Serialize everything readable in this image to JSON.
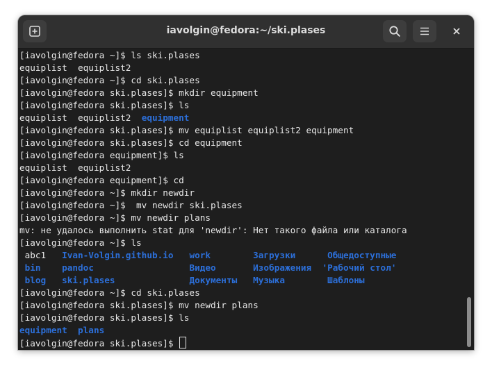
{
  "window": {
    "title": "iavolgin@fedora:~/ski.plases"
  },
  "terminal": {
    "lines": [
      [
        {
          "t": "[iavolgin@fedora ~]$ ls ski.plases"
        }
      ],
      [
        {
          "t": "equiplist  equiplist2"
        }
      ],
      [
        {
          "t": "[iavolgin@fedora ~]$ cd ski.plases"
        }
      ],
      [
        {
          "t": "[iavolgin@fedora ski.plases]$ mkdir equipment"
        }
      ],
      [
        {
          "t": "[iavolgin@fedora ski.plases]$ ls"
        }
      ],
      [
        {
          "t": "equiplist  equiplist2  "
        },
        {
          "t": "equipment",
          "dir": true
        }
      ],
      [
        {
          "t": "[iavolgin@fedora ski.plases]$ mv equiplist equiplist2 equipment"
        }
      ],
      [
        {
          "t": "[iavolgin@fedora ski.plases]$ cd equipment"
        }
      ],
      [
        {
          "t": "[iavolgin@fedora equipment]$ ls"
        }
      ],
      [
        {
          "t": "equiplist  equiplist2"
        }
      ],
      [
        {
          "t": "[iavolgin@fedora equipment]$ cd"
        }
      ],
      [
        {
          "t": "[iavolgin@fedora ~]$ mkdir newdir"
        }
      ],
      [
        {
          "t": "[iavolgin@fedora ~]$  mv newdir ski.plases"
        }
      ],
      [
        {
          "t": "[iavolgin@fedora ~]$ mv newdir plans"
        }
      ],
      [
        {
          "t": "mv: не удалось выполнить stat для 'newdir': Нет такого файла или каталога"
        }
      ],
      [
        {
          "t": "[iavolgin@fedora ~]$ ls"
        }
      ],
      [
        {
          "t": " abc1   "
        },
        {
          "t": "Ivan-Volgin.github.io",
          "dir": true
        },
        {
          "t": "   "
        },
        {
          "t": "work",
          "dir": true
        },
        {
          "t": "        "
        },
        {
          "t": "Загрузки",
          "dir": true
        },
        {
          "t": "      "
        },
        {
          "t": "Общедоступные",
          "dir": true
        }
      ],
      [
        {
          "t": " "
        },
        {
          "t": "bin",
          "dir": true
        },
        {
          "t": "    "
        },
        {
          "t": "pandoc",
          "dir": true
        },
        {
          "t": "                  "
        },
        {
          "t": "Видео",
          "dir": true
        },
        {
          "t": "       "
        },
        {
          "t": "Изображения",
          "dir": true
        },
        {
          "t": "  "
        },
        {
          "t": "'Рабочий стол'",
          "dir": true
        }
      ],
      [
        {
          "t": " "
        },
        {
          "t": "blog",
          "dir": true
        },
        {
          "t": "   "
        },
        {
          "t": "ski.plases",
          "dir": true
        },
        {
          "t": "              "
        },
        {
          "t": "Документы",
          "dir": true
        },
        {
          "t": "   "
        },
        {
          "t": "Музыка",
          "dir": true
        },
        {
          "t": "        "
        },
        {
          "t": "Шаблоны",
          "dir": true
        }
      ],
      [
        {
          "t": "[iavolgin@fedora ~]$ cd ski.plases"
        }
      ],
      [
        {
          "t": "[iavolgin@fedora ski.plases]$ mv newdir plans"
        }
      ],
      [
        {
          "t": "[iavolgin@fedora ski.plases]$ ls"
        }
      ],
      [
        {
          "t": "equipment",
          "dir": true
        },
        {
          "t": "  "
        },
        {
          "t": "plans",
          "dir": true
        }
      ],
      [
        {
          "t": "[iavolgin@fedora ski.plases]$ "
        }
      ]
    ],
    "cursor_line": 23
  },
  "icons": {
    "new_tab": "new-tab-icon",
    "search": "search-icon",
    "menu": "hamburger-menu-icon",
    "close": "close-icon"
  },
  "colors": {
    "background": "#1e1e1e",
    "titlebar": "#303030",
    "foreground": "#e8e8e8",
    "directory": "#2c6fd9"
  }
}
